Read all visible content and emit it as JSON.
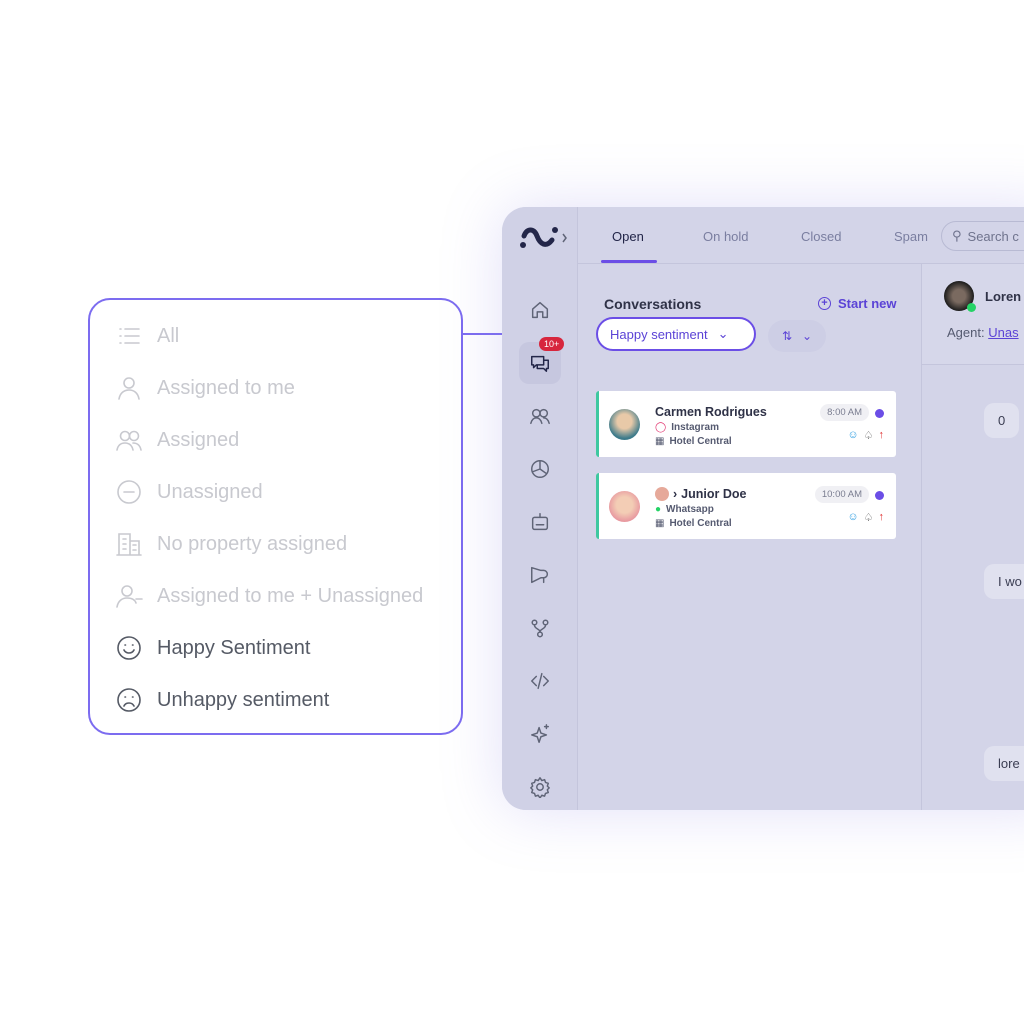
{
  "dropdown": {
    "items": [
      {
        "label": "All",
        "icon": "list-icon",
        "active": false
      },
      {
        "label": "Assigned to me",
        "icon": "user-icon",
        "active": false
      },
      {
        "label": "Assigned",
        "icon": "users-icon",
        "active": false
      },
      {
        "label": "Unassigned",
        "icon": "minus-circle-icon",
        "active": false
      },
      {
        "label": "No property assigned",
        "icon": "building-icon",
        "active": false
      },
      {
        "label": "Assigned to me + Unassigned",
        "icon": "user-minus-icon",
        "active": false
      },
      {
        "label": "Happy Sentiment",
        "icon": "smile-icon",
        "active": true
      },
      {
        "label": "Unhappy sentiment",
        "icon": "frown-icon",
        "active": true
      }
    ]
  },
  "sidebar": {
    "badge": "10+"
  },
  "tabs": [
    "Open",
    "On hold",
    "Closed",
    "Spam"
  ],
  "search": {
    "placeholder": "Search c"
  },
  "conversations": {
    "title": "Conversations",
    "start_new": "Start new",
    "filter": "Happy sentiment",
    "items": [
      {
        "name": "Carmen Rodrigues",
        "channel": "Instagram",
        "property": "Hotel Central",
        "time": "8:00 AM"
      },
      {
        "name": "Junior Doe",
        "channel": "Whatsapp",
        "property": "Hotel Central",
        "time": "10:00 AM"
      }
    ]
  },
  "chat": {
    "contact": "Loren",
    "agent_label": "Agent:",
    "agent_value": "Unas",
    "messages": [
      "0",
      "I wo",
      "lore"
    ]
  },
  "colors": {
    "accent": "#6b4ee6",
    "border": "#7c6cf0",
    "badge": "#d7263d"
  }
}
